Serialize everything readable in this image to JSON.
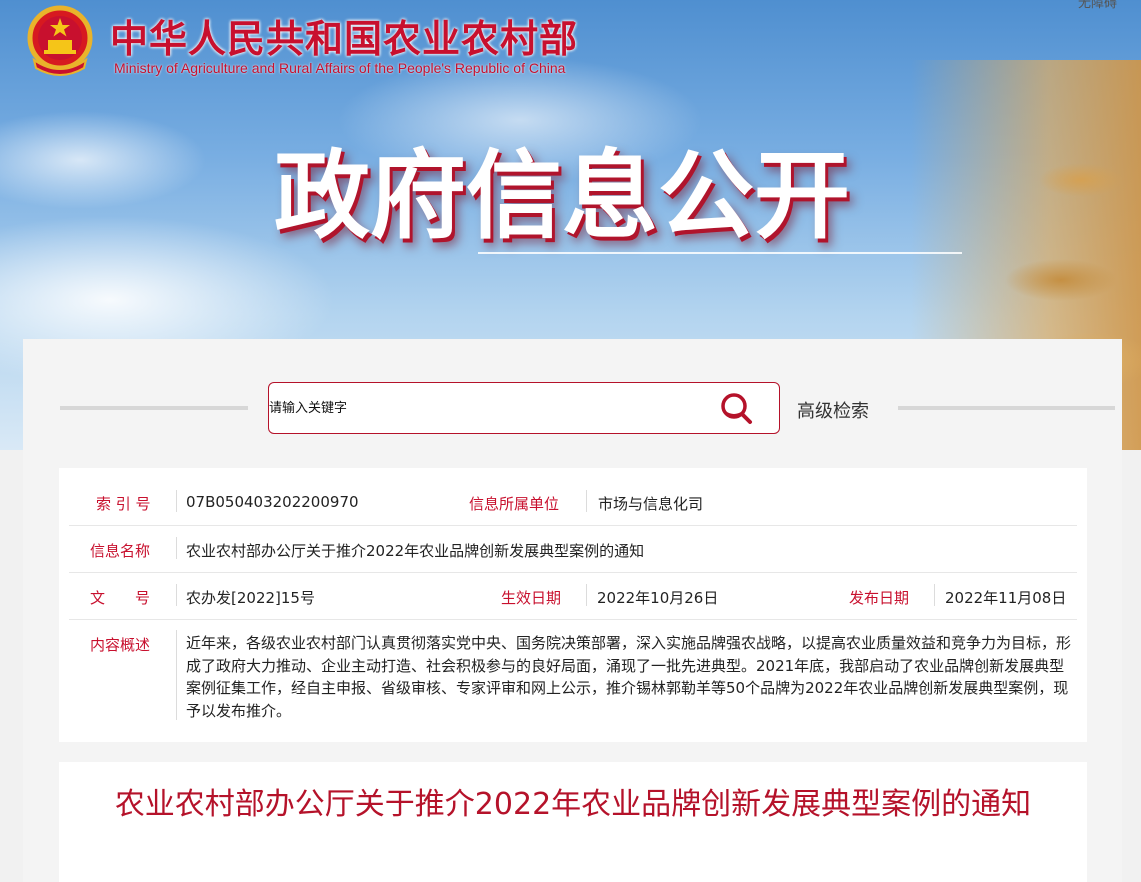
{
  "header": {
    "ministry_name_cn": "中华人民共和国农业农村部",
    "ministry_name_en": "Ministry of Agriculture and Rural Affairs of the People's Republic of China",
    "accessibility_link": "无障碍",
    "emblem_icon": "national-emblem-icon"
  },
  "hero": {
    "title": "政府信息公开"
  },
  "search": {
    "placeholder": "请输入关键字",
    "advanced_label": "高级检索",
    "icon": "search-icon",
    "accent_color": "#b5122a"
  },
  "meta": {
    "index_no": {
      "label": "索 引 号",
      "value": "07B050403202200970"
    },
    "department": {
      "label": "信息所属单位",
      "value": "市场与信息化司"
    },
    "info_name": {
      "label": "信息名称",
      "value": "农业农村部办公厅关于推介2022年农业品牌创新发展典型案例的通知"
    },
    "doc_no": {
      "label": "文　　号",
      "value": "农办发[2022]15号"
    },
    "effective_date": {
      "label": "生效日期",
      "value": "2022年10月26日"
    },
    "publish_date": {
      "label": "发布日期",
      "value": "2022年11月08日"
    },
    "summary": {
      "label": "内容概述",
      "value": "近年来，各级农业农村部门认真贯彻落实党中央、国务院决策部署，深入实施品牌强农战略，以提高农业质量效益和竞争力为目标，形成了政府大力推动、企业主动打造、社会积极参与的良好局面，涌现了一批先进典型。2021年底，我部启动了农业品牌创新发展典型案例征集工作，经自主申报、省级审核、专家评审和网上公示，推介锡林郭勒羊等50个品牌为2022年农业品牌创新发展典型案例，现予以发布推介。"
    }
  },
  "article": {
    "title": "农业农村部办公厅关于推介2022年农业品牌创新发展典型案例的通知"
  }
}
